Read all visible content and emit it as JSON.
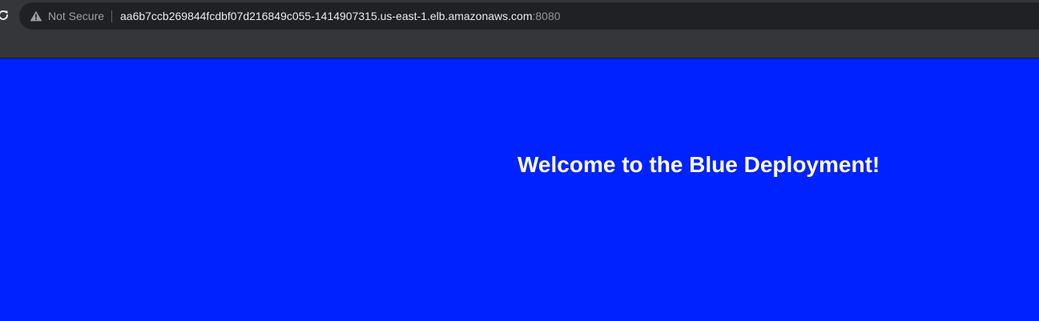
{
  "browser": {
    "security_label": "Not Secure",
    "url_host": "aa6b7ccb269844fcdbf07d216849c055-1414907315.us-east-1.elb.amazonaws.com",
    "url_port": ":8080",
    "icons": [
      "reload-icon",
      "warning-icon"
    ]
  },
  "page": {
    "heading": "Welcome to the Blue Deployment!",
    "background_color": "#0022ff",
    "text_color": "#ffffff"
  }
}
